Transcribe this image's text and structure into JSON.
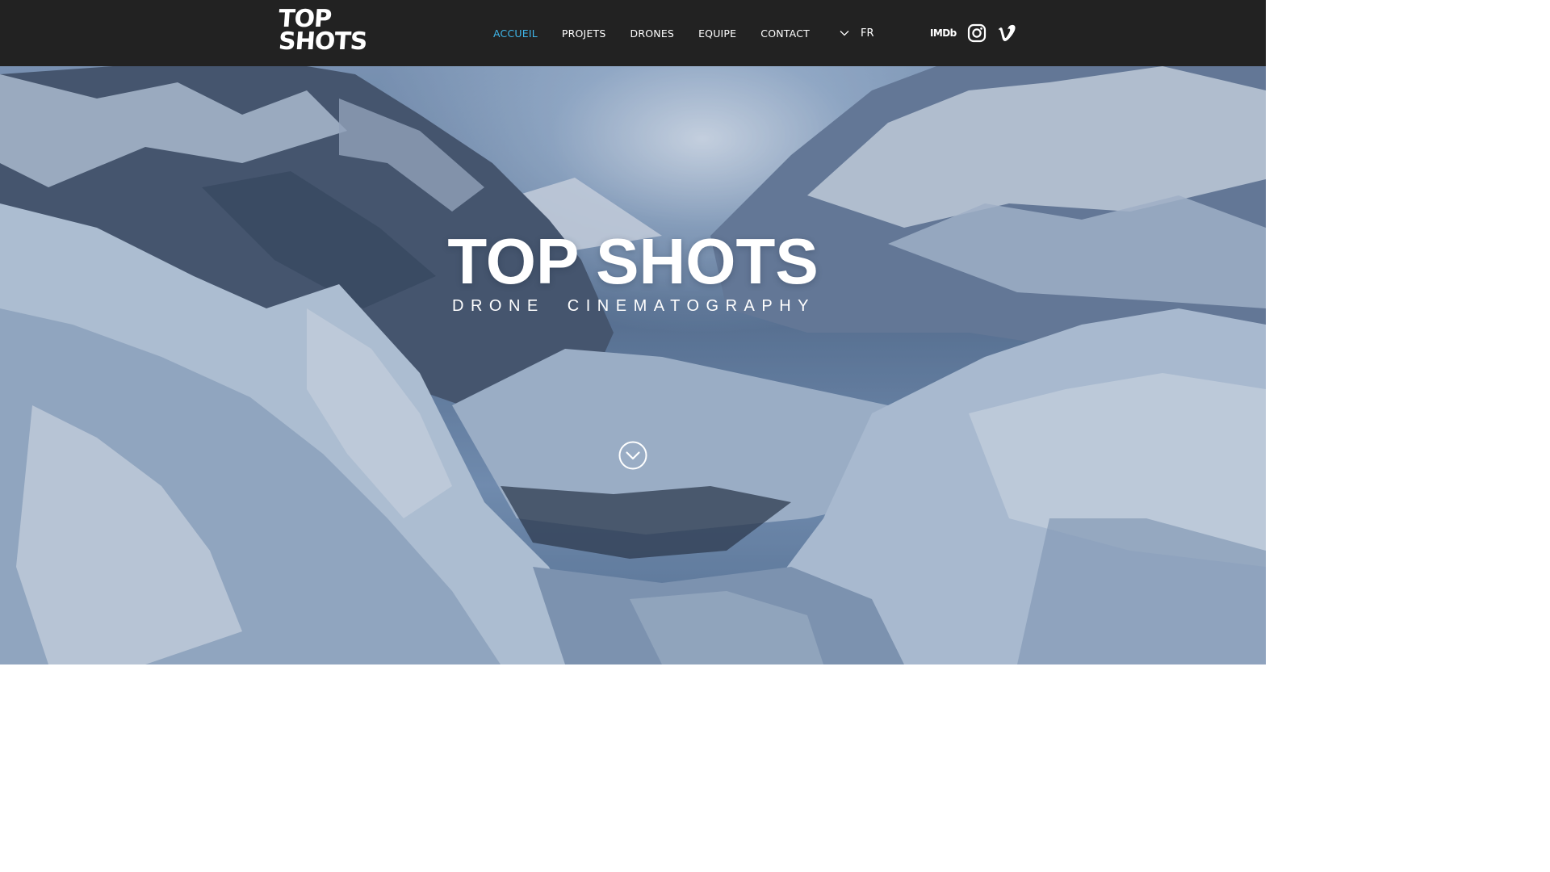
{
  "header": {
    "logo": {
      "line1": "TOP",
      "line2": "SHOTS"
    },
    "nav": [
      {
        "label": "ACCUEIL",
        "active": true
      },
      {
        "label": "PROJETS",
        "active": false
      },
      {
        "label": "DRONES",
        "active": false
      },
      {
        "label": "EQUIPE",
        "active": false
      },
      {
        "label": "CONTACT",
        "active": false
      }
    ],
    "language": {
      "current": "FR",
      "icon": "chevron-down-icon"
    },
    "social": {
      "imdb_label": "IMDb",
      "instagram_icon": "instagram-icon",
      "vimeo_icon": "vimeo-icon"
    }
  },
  "hero": {
    "title": "TOP SHOTS",
    "subtitle": "DRONE CINEMATOGRAPHY",
    "scroll_icon": "chevron-down-circle-icon"
  },
  "colors": {
    "header_bg": "#222222",
    "nav_active": "#3fb6ea",
    "text": "#ffffff"
  }
}
